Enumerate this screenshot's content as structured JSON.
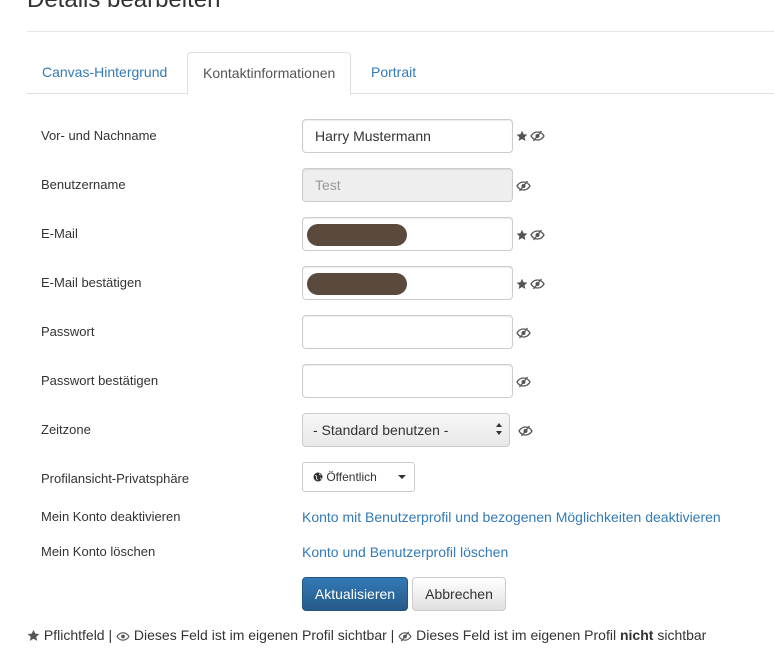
{
  "page": {
    "title": "Details bearbeiten"
  },
  "tabs": [
    {
      "label": "Canvas-Hintergrund"
    },
    {
      "label": "Kontaktinformationen",
      "active": true
    },
    {
      "label": "Portrait"
    }
  ],
  "form": {
    "name": {
      "label": "Vor- und Nachname",
      "value": "Harry Mustermann",
      "required": true,
      "visible": false
    },
    "username": {
      "label": "Benutzername",
      "value": "Test",
      "disabled": true,
      "visible": false
    },
    "email": {
      "label": "E-Mail",
      "value": "",
      "redacted": true,
      "required": true,
      "visible": false
    },
    "email_confirm": {
      "label": "E-Mail bestätigen",
      "value": "",
      "redacted": true,
      "required": true,
      "visible": false
    },
    "password": {
      "label": "Passwort",
      "value": "",
      "visible": false
    },
    "password_confirm": {
      "label": "Passwort bestätigen",
      "value": "",
      "visible": false
    },
    "timezone": {
      "label": "Zeitzone",
      "selected": "- Standard benutzen -",
      "visible": false
    },
    "privacy": {
      "label": "Profilansicht-Privatsphäre",
      "selected": "Öffentlich"
    },
    "deactivate": {
      "label": "Mein Konto deaktivieren",
      "link": "Konto mit Benutzerprofil und bezogenen Möglichkeiten deaktivieren"
    },
    "delete": {
      "label": "Mein Konto löschen",
      "link": "Konto und Benutzerprofil löschen"
    }
  },
  "buttons": {
    "submit": "Aktualisieren",
    "cancel": "Abbrechen"
  },
  "legend": {
    "required": "Pflichtfeld |",
    "visible": "Dieses Feld ist im eigenen Profil sichtbar |",
    "hidden_prefix": "Dieses Feld ist im eigenen Profil",
    "hidden_bold": "nicht",
    "hidden_suffix": "sichtbar"
  },
  "colors": {
    "link": "#337ab7",
    "primary": "#2e6da4",
    "redaction": "#5a4a3d"
  }
}
